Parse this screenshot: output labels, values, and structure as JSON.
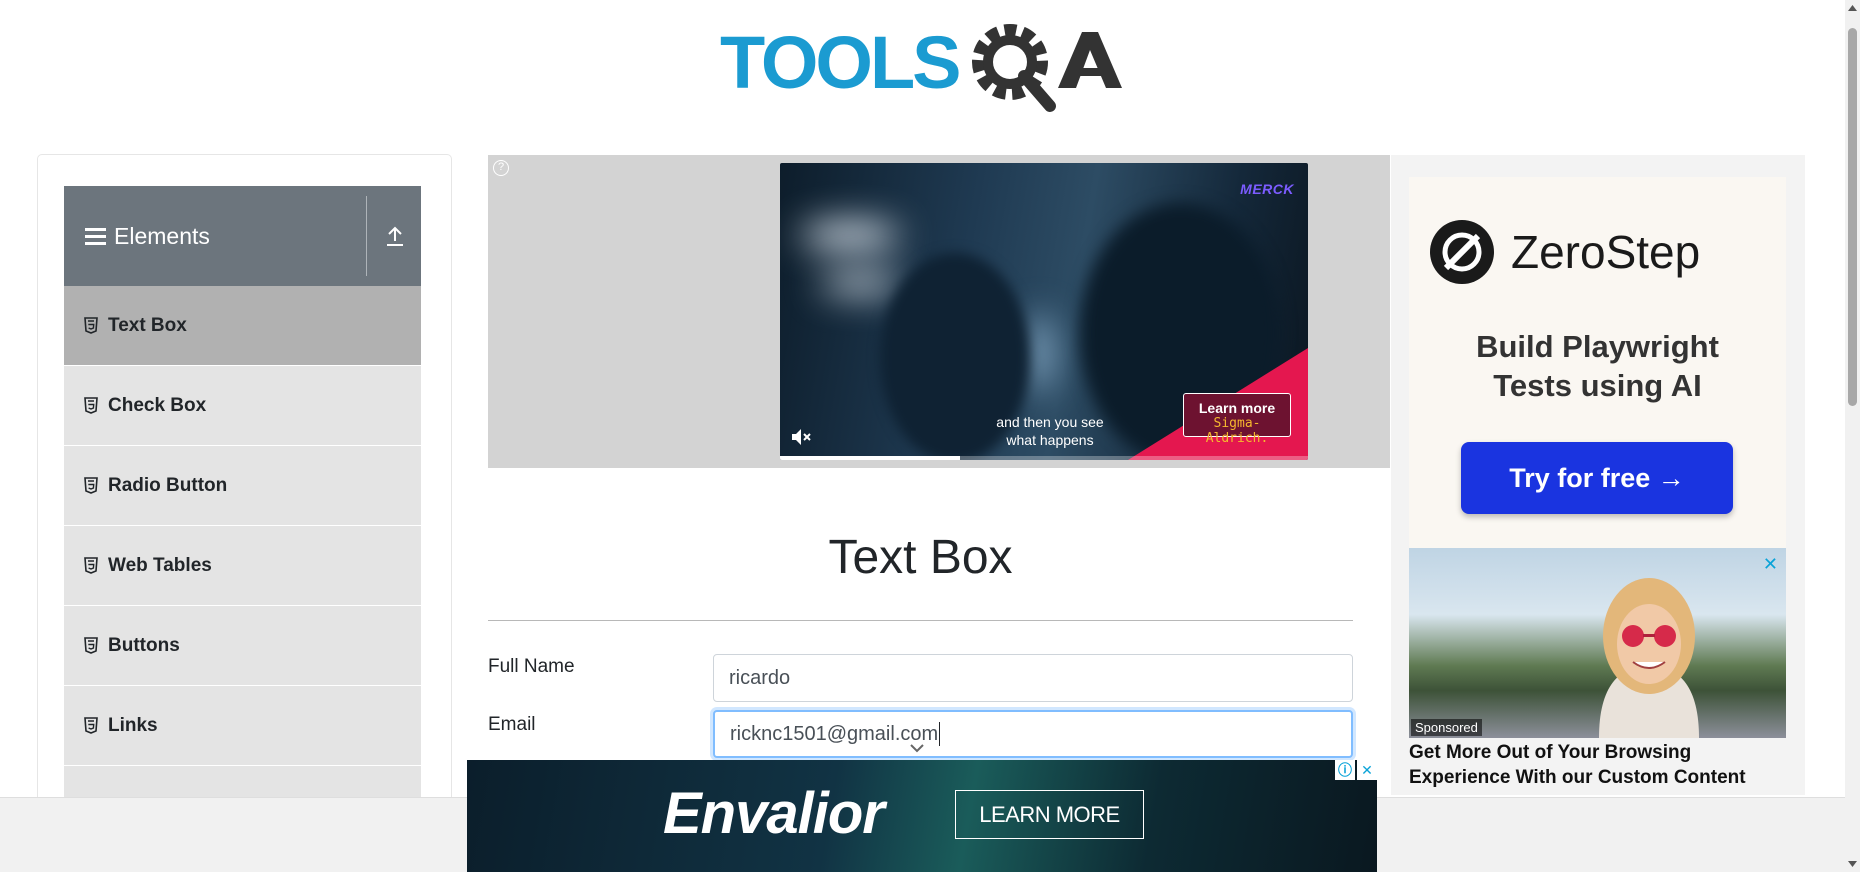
{
  "header": {
    "logo_text": "TOOLSQA"
  },
  "sidebar": {
    "group_title": "Elements",
    "items": [
      {
        "label": "Text Box",
        "active": true
      },
      {
        "label": "Check Box"
      },
      {
        "label": "Radio Button"
      },
      {
        "label": "Web Tables"
      },
      {
        "label": "Buttons"
      },
      {
        "label": "Links"
      }
    ]
  },
  "top_ad": {
    "brand": "MERCK",
    "caption": "and then you see what happens",
    "cta_label": "Learn more",
    "cta_sub": "Sigma-Aldrich.",
    "progress": 0.34
  },
  "main": {
    "title": "Text Box",
    "full_name_label": "Full Name",
    "full_name_value": "ricardo",
    "email_label": "Email",
    "email_value": "ricknc1501@gmail.com"
  },
  "right_ad": {
    "brand": "ZeroStep",
    "headline_line1": "Build Playwright",
    "headline_line2": "Tests using AI",
    "cta_label": "Try for free →",
    "sponsored_label": "Sponsored",
    "ad2_text": "Get More Out of Your Browsing Experience With our Custom Content"
  },
  "bottom_ad": {
    "brand": "Envalior",
    "cta_label": "LEARN MORE"
  },
  "colors": {
    "sidebar_header": "#6c757d",
    "sidebar_active": "#b1b1b1",
    "sidebar_item": "#e4e4e4",
    "logo_blue": "#1b9bd1",
    "logo_dark": "#333333",
    "zerostep_cta": "#1a34e0",
    "focus_border": "#80bdff"
  }
}
